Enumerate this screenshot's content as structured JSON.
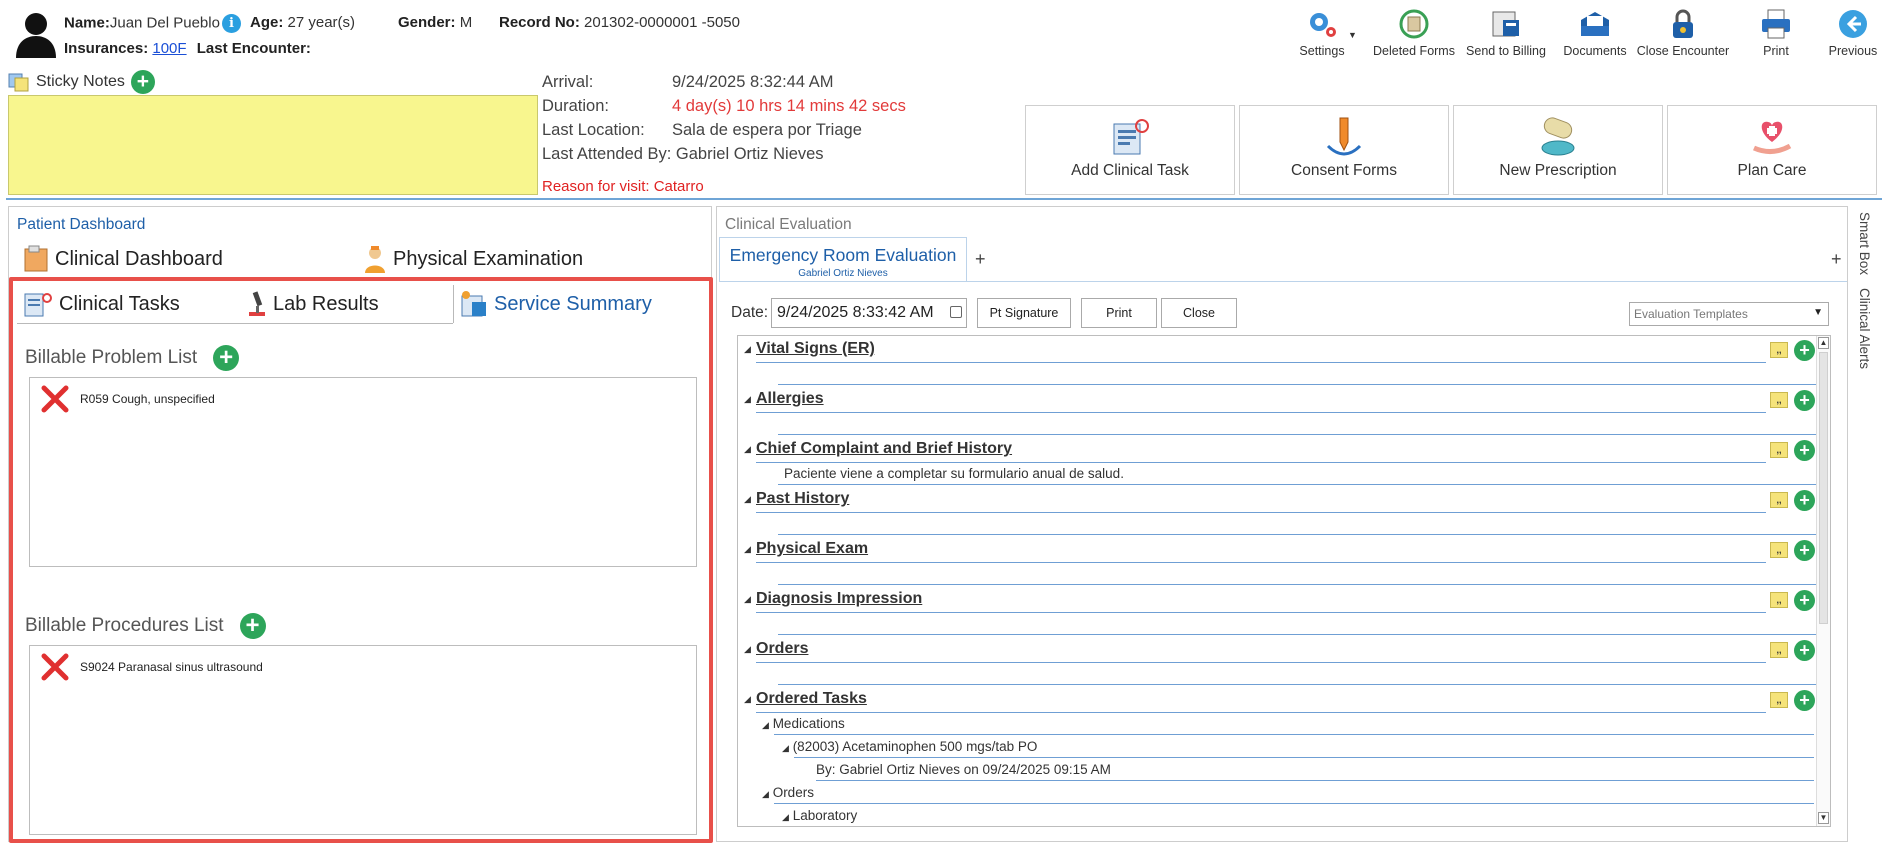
{
  "patient": {
    "name_label": "Name:",
    "name": "Juan Del Pueblo",
    "age_label": "Age:",
    "age": "27 year(s)",
    "gender_label": "Gender:",
    "gender": "M",
    "record_label": "Record No:",
    "record": "201302-0000001 -5050",
    "insurances_label": "Insurances:",
    "insurance": "100F",
    "last_encounter_label": "Last Encounter:"
  },
  "toolbar": {
    "settings": "Settings",
    "deleted_forms": "Deleted Forms",
    "send_to_billing": "Send to Billing",
    "documents": "Documents",
    "close_encounter": "Close Encounter",
    "print": "Print",
    "previous": "Previous"
  },
  "sticky": {
    "title": "Sticky Notes"
  },
  "encounter": {
    "arrival_label": "Arrival:",
    "arrival": "9/24/2025 8:32:44 AM",
    "duration_label": "Duration:",
    "duration": "4 day(s) 10 hrs 14 mins 42 secs",
    "last_location_label": "Last Location:",
    "last_location": "Sala de espera por Triage",
    "last_attended": "Last Attended By: Gabriel Ortiz Nieves",
    "reason": "Reason for visit: Catarro"
  },
  "actions": {
    "add_clinical_task": "Add Clinical Task",
    "consent_forms": "Consent Forms",
    "new_prescription": "New Prescription",
    "plan_care": "Plan Care"
  },
  "dashboard": {
    "title": "Patient Dashboard",
    "tab_clinical_dashboard": "Clinical Dashboard",
    "tab_physical_exam": "Physical Examination",
    "subtab_clinical_tasks": "Clinical Tasks",
    "subtab_lab_results": "Lab Results",
    "subtab_service_summary": "Service Summary",
    "billable_problem_title": "Billable Problem List",
    "problems": [
      "R059 Cough, unspecified"
    ],
    "billable_procedures_title": "Billable Procedures List",
    "procedures": [
      "S9024 Paranasal sinus ultrasound"
    ]
  },
  "evaluation": {
    "title": "Clinical Evaluation",
    "tab_title": "Emergency Room Evaluation",
    "tab_sub": "Gabriel Ortiz Nieves",
    "date_label": "Date:",
    "date_value": "9/24/2025 8:33:42 AM",
    "pt_signature": "Pt Signature",
    "print": "Print",
    "close": "Close",
    "templates_placeholder": "Evaluation Templates",
    "sections": [
      "Vital Signs (ER)",
      "Allergies",
      "Chief Complaint and Brief History",
      "Past History",
      "Physical Exam",
      "Diagnosis Impression",
      "Orders",
      "Ordered Tasks"
    ],
    "chief_complaint_text": "Paciente viene a completar su formulario anual de salud.",
    "tree": {
      "medications": "Medications",
      "med_item": "(82003) Acetaminophen 500 mgs/tab PO",
      "med_by": "By: Gabriel Ortiz Nieves on 09/24/2025 09:15 AM",
      "orders": "Orders",
      "laboratory": "Laboratory"
    }
  },
  "sidebar": {
    "smart_box": "Smart Box",
    "clinical_alerts": "Clinical Alerts"
  },
  "colors": {
    "accent_blue": "#1e5fa8",
    "highlight_red": "#e8504a",
    "add_green": "#2da55a",
    "sticky_yellow": "#f8f68e",
    "alert_red": "#e23a3a"
  }
}
